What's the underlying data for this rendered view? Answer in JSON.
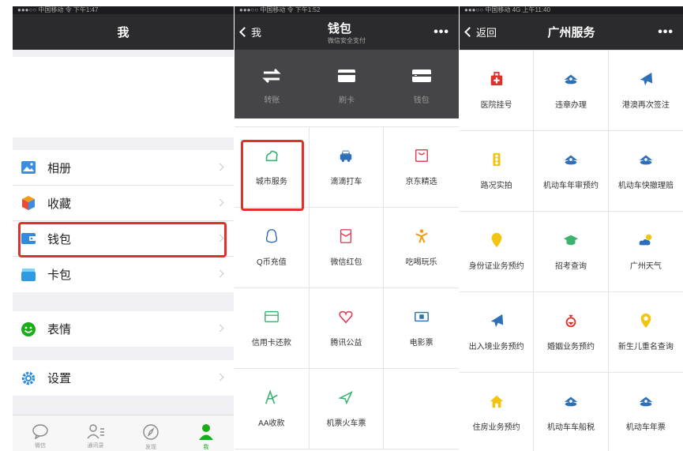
{
  "panel1": {
    "status": "●●●○○ 中国移动 令 下午1:47",
    "title": "我",
    "group1": [
      {
        "icon": "photo-album-icon",
        "label": "相册"
      },
      {
        "icon": "favorites-cube-icon",
        "label": "收藏"
      },
      {
        "icon": "wallet-icon",
        "label": "钱包"
      },
      {
        "icon": "card-pack-icon",
        "label": "卡包"
      }
    ],
    "group2": [
      {
        "icon": "smiley-icon",
        "label": "表情"
      }
    ],
    "group3": [
      {
        "icon": "settings-gear-icon",
        "label": "设置"
      }
    ],
    "tabs": [
      {
        "icon": "chat-bubble-icon",
        "label": "微信"
      },
      {
        "icon": "contacts-icon",
        "label": "通讯录"
      },
      {
        "icon": "compass-icon",
        "label": "发现"
      },
      {
        "icon": "me-person-icon",
        "label": "我"
      }
    ],
    "highlight_row": "钱包"
  },
  "panel2": {
    "status": "●●●○○ 中国移动 令 下午1:52",
    "back": "我",
    "title": "钱包",
    "subtitle": "微信安全支付",
    "more": "•••",
    "top": [
      {
        "icon": "transfer-icon",
        "label": "转账"
      },
      {
        "icon": "card-icon",
        "label": "刷卡"
      },
      {
        "icon": "wallet-icon",
        "label": "钱包"
      }
    ],
    "services": [
      {
        "icon": "city-service-icon",
        "label": "城市服务",
        "color": "#3cb371"
      },
      {
        "icon": "taxi-icon",
        "label": "滴滴打车",
        "color": "#2f6fb8"
      },
      {
        "icon": "jd-bag-icon",
        "label": "京东精选",
        "color": "#e0405a"
      },
      {
        "icon": "qq-penguin-icon",
        "label": "Q币充值",
        "color": "#2f6fb8"
      },
      {
        "icon": "red-envelope-icon",
        "label": "微信红包",
        "color": "#e0405a"
      },
      {
        "icon": "food-fun-icon",
        "label": "吃喝玩乐",
        "color": "#f39c12"
      },
      {
        "icon": "credit-card-icon",
        "label": "信用卡还款",
        "color": "#3cb371"
      },
      {
        "icon": "charity-heart-icon",
        "label": "腾讯公益",
        "color": "#e0405a"
      },
      {
        "icon": "movie-ticket-icon",
        "label": "电影票",
        "color": "#2f6fb8"
      },
      {
        "icon": "aa-payment-icon",
        "label": "AA收款",
        "color": "#3cb371"
      },
      {
        "icon": "plane-ticket-icon",
        "label": "机票火车票",
        "color": "#3cb371"
      },
      {
        "icon": "empty-icon",
        "label": "",
        "color": "#ffffff"
      }
    ],
    "highlight_cell": "城市服务"
  },
  "panel3": {
    "status": "●●●○○ 中国移动 4G 上午11:40",
    "back": "返回",
    "title": "广州服务",
    "more": "•••",
    "services": [
      {
        "icon": "hospital-icon",
        "label": "医院挂号",
        "color": "#e0302b"
      },
      {
        "icon": "police-badge-icon",
        "label": "违章办理",
        "color": "#2f6fb8"
      },
      {
        "icon": "airplane-icon",
        "label": "港澳再次签注",
        "color": "#2f6fb8"
      },
      {
        "icon": "traffic-light-icon",
        "label": "路况实拍",
        "color": "#f1c40f"
      },
      {
        "icon": "police-badge-icon",
        "label": "机动车年审预约",
        "color": "#2f6fb8"
      },
      {
        "icon": "police-badge-icon",
        "label": "机动车快撤理赔",
        "color": "#2f6fb8"
      },
      {
        "icon": "id-pin-icon",
        "label": "身份证业务预约",
        "color": "#f1c40f"
      },
      {
        "icon": "graduation-cap-icon",
        "label": "招考查询",
        "color": "#3cb371"
      },
      {
        "icon": "weather-icon",
        "label": "广州天气",
        "color": "#2f6fb8"
      },
      {
        "icon": "airplane-icon",
        "label": "出入境业务预约",
        "color": "#2f6fb8"
      },
      {
        "icon": "marriage-icon",
        "label": "婚姻业务预约",
        "color": "#e0302b"
      },
      {
        "icon": "baby-pin-icon",
        "label": "新生儿重名查询",
        "color": "#f1c40f"
      },
      {
        "icon": "house-icon",
        "label": "住房业务预约",
        "color": "#f1c40f"
      },
      {
        "icon": "police-badge-icon",
        "label": "机动车车船税",
        "color": "#2f6fb8"
      },
      {
        "icon": "police-badge-icon",
        "label": "机动车年票",
        "color": "#2f6fb8"
      }
    ]
  }
}
